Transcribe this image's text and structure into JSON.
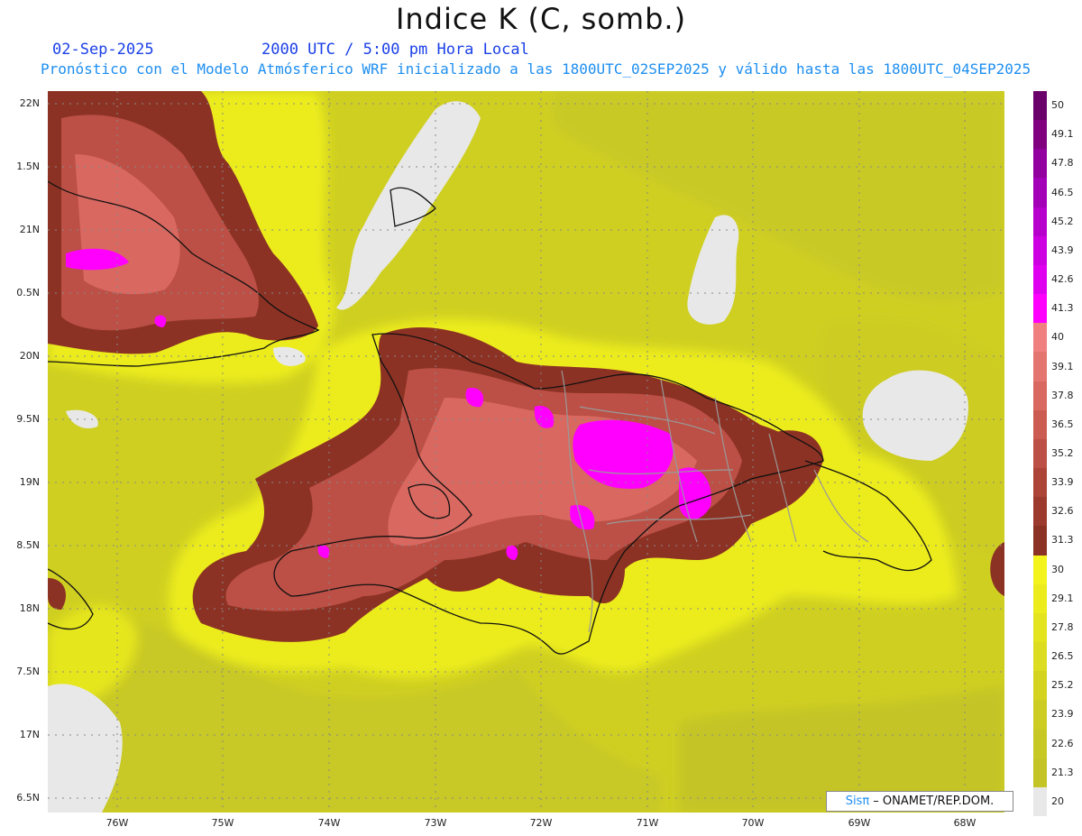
{
  "title": "Indice K (C, somb.)",
  "header": {
    "date": "02-Sep-2025",
    "time": "2000 UTC / 5:00 pm Hora Local",
    "subtitle": "Pronóstico con el Modelo Atmósferico WRF inicializado a las 1800UTC_02SEP2025 y válido hasta las  1800UTC_04SEP2025"
  },
  "axes": {
    "lat_labels": [
      "22N",
      "1.5N",
      "21N",
      "0.5N",
      "20N",
      "9.5N",
      "19N",
      "8.5N",
      "18N",
      "7.5N",
      "17N",
      "6.5N"
    ],
    "lon_labels": [
      "76W",
      "75W",
      "74W",
      "73W",
      "72W",
      "71W",
      "70W",
      "69W",
      "68W"
    ]
  },
  "colorbar": {
    "labels": [
      "50",
      "49.1",
      "47.8",
      "46.5",
      "45.2",
      "43.9",
      "42.6",
      "41.3",
      "40",
      "39.1",
      "37.8",
      "36.5",
      "35.2",
      "33.9",
      "32.6",
      "31.3",
      "30",
      "29.1",
      "27.8",
      "26.5",
      "25.2",
      "23.9",
      "22.6",
      "21.3",
      "20"
    ],
    "colors": [
      "#6a006a",
      "#800080",
      "#9200a0",
      "#a400b8",
      "#b800cc",
      "#cc00e0",
      "#e000f0",
      "#ff00ff",
      "#f08080",
      "#e47470",
      "#d86860",
      "#cc5c52",
      "#bc5046",
      "#ac4438",
      "#9c3a2e",
      "#8c3224",
      "#f4f41c",
      "#ecec1c",
      "#e4e41e",
      "#dcdc20",
      "#d4d420",
      "#cccc22",
      "#c8c824",
      "#c4c426",
      "#e8e8e8"
    ]
  },
  "credit": {
    "brand": "Sisπ",
    "org": " – ONAMET/REP.DOM."
  }
}
